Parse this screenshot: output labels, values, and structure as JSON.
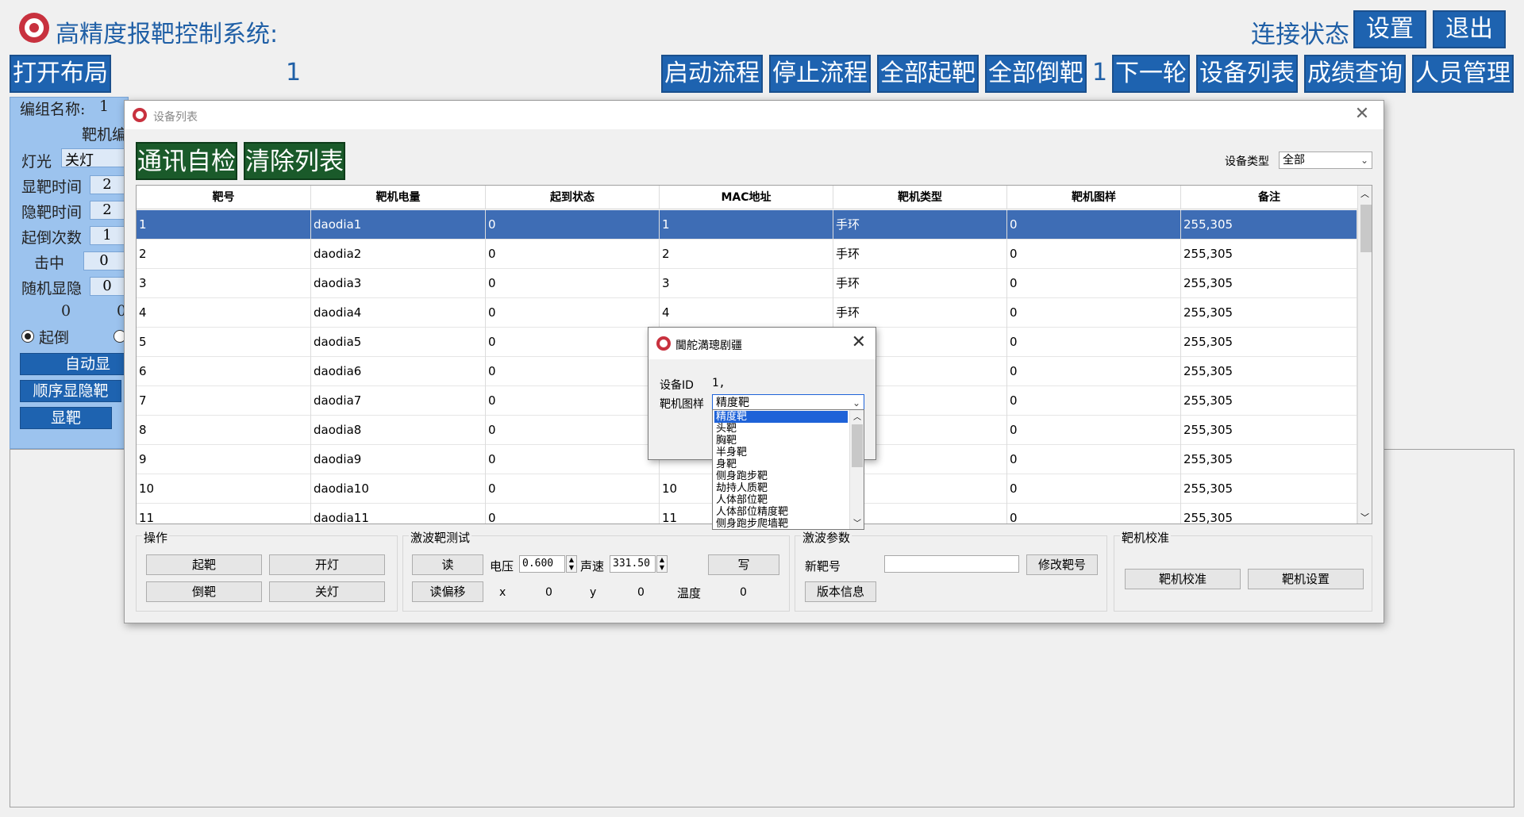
{
  "header": {
    "title": "高精度报靶控制系统:",
    "connection_label": "连接状态",
    "settings_btn": "设置",
    "exit_btn": "退出"
  },
  "toolbar": {
    "open_layout": "打开布局",
    "layout_number": "1",
    "start_flow": "启动流程",
    "stop_flow": "停止流程",
    "all_raise": "全部起靶",
    "all_fall": "全部倒靶",
    "round_number": "1",
    "next_round": "下一轮",
    "device_list": "设备列表",
    "score_query": "成绩查询",
    "personnel": "人员管理"
  },
  "left_panel": {
    "group_name_label": "编组名称:",
    "group_name_value": "1",
    "target_edit_label": "靶机编",
    "light_label": "灯光",
    "light_value": "关灯",
    "show_time_label": "显靶时间",
    "show_time_value": "2",
    "hide_time_label": "隐靶时间",
    "hide_time_value": "2",
    "raise_count_label": "起倒次数",
    "raise_count_value": "1",
    "hit_label": "击中",
    "hit_value": "0",
    "random_label": "随机显隐",
    "random_value": "0",
    "v1": "0",
    "v2": "0",
    "radio_label": "起倒",
    "auto_btn": "自动显",
    "seq_btn": "顺序显隐靶",
    "show_btn": "显靶"
  },
  "dialog": {
    "title": "设备列表",
    "comm_check": "通讯自检",
    "clear_list": "清除列表",
    "device_type_label": "设备类型",
    "device_type_value": "全部",
    "columns": [
      "靶号",
      "靶机电量",
      "起到状态",
      "MAC地址",
      "靶机类型",
      "靶机图样",
      "备注"
    ],
    "rows": [
      [
        "1",
        "daodia1",
        "0",
        "1",
        "手环",
        "0",
        "255,305"
      ],
      [
        "2",
        "daodia2",
        "0",
        "2",
        "手环",
        "0",
        "255,305"
      ],
      [
        "3",
        "daodia3",
        "0",
        "3",
        "手环",
        "0",
        "255,305"
      ],
      [
        "4",
        "daodia4",
        "0",
        "4",
        "手环",
        "0",
        "255,305"
      ],
      [
        "5",
        "daodia5",
        "0",
        "",
        "",
        "0",
        "255,305"
      ],
      [
        "6",
        "daodia6",
        "0",
        "",
        "",
        "0",
        "255,305"
      ],
      [
        "7",
        "daodia7",
        "0",
        "",
        "",
        "0",
        "255,305"
      ],
      [
        "8",
        "daodia8",
        "0",
        "",
        "",
        "0",
        "255,305"
      ],
      [
        "9",
        "daodia9",
        "0",
        "",
        "",
        "0",
        "255,305"
      ],
      [
        "10",
        "daodia10",
        "0",
        "10",
        "",
        "0",
        "255,305"
      ],
      [
        "11",
        "daodia11",
        "0",
        "11",
        "",
        "0",
        "255,305"
      ]
    ],
    "ops": {
      "label": "操作",
      "raise": "起靶",
      "light_on": "开灯",
      "fall": "倒靶",
      "light_off": "关灯"
    },
    "laser_test": {
      "label": "激波靶测试",
      "read": "读",
      "voltage_label": "电压",
      "voltage_value": "0.600",
      "sound_label": "声速",
      "sound_value": "331.50",
      "write": "写",
      "read_offset": "读偏移",
      "x_label": "x",
      "x_value": "0",
      "y_label": "y",
      "y_value": "0",
      "temp_label": "温度",
      "temp_value": "0"
    },
    "laser_params": {
      "label": "激波参数",
      "new_target_label": "新靶号",
      "new_target_value": "",
      "modify_btn": "修改靶号",
      "version_btn": "版本信息"
    },
    "calibration": {
      "label": "靶机校准",
      "calibrate_btn": "靶机校准",
      "settings_btn": "靶机设置"
    }
  },
  "popup": {
    "title": "閫舵満璁剧疆",
    "device_id_label": "设备ID",
    "device_id_value": "1,",
    "pattern_label": "靶机图样",
    "pattern_value": "精度靶",
    "options": [
      "精度靶",
      "头靶",
      "胸靶",
      "半身靶",
      "身靶",
      "侧身跑步靶",
      "劫持人质靶",
      "人体部位靶",
      "人体部位精度靶",
      "侧身跑步爬墙靶"
    ]
  },
  "colors": {
    "accent_blue": "#1e63b0",
    "dark_green": "#1a5a2a",
    "selection": "#3e6db5"
  }
}
